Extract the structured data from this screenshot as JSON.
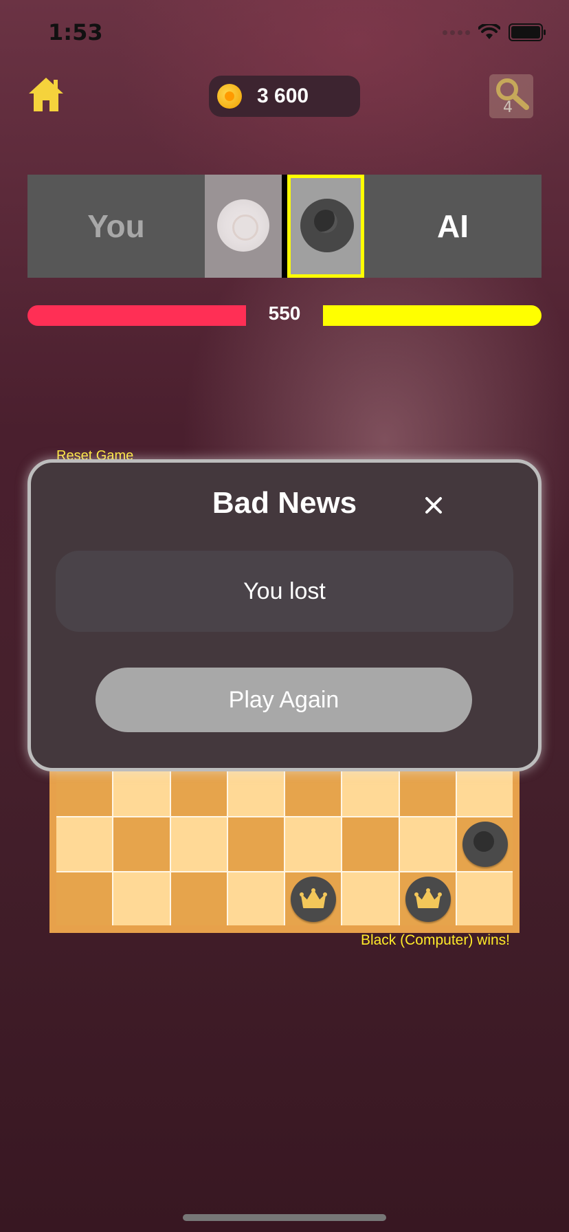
{
  "status_bar": {
    "time": "1:53"
  },
  "top_bar": {
    "coins": "3 600",
    "hint_count": "4"
  },
  "players": {
    "you_label": "You",
    "ai_label": "AI",
    "active_player": "AI",
    "score": "550",
    "colors": {
      "you_bar": "#ff2f55",
      "ai_bar": "#ffff00",
      "active_highlight": "#ffff00"
    }
  },
  "game": {
    "reset_label": "Reset Game",
    "result_text": "Black (Computer) wins!",
    "visible_board_rows": [
      [
        "d",
        "l",
        "d",
        "l",
        "d",
        "l",
        "d",
        "l"
      ],
      [
        "l",
        "d",
        "l",
        "d",
        "l",
        "d",
        "l",
        "d"
      ],
      [
        "d",
        "l",
        "d",
        "l",
        "d",
        "l",
        "d",
        "l"
      ]
    ],
    "pieces": [
      {
        "row": 1,
        "col": 7,
        "color": "black",
        "king": false
      },
      {
        "row": 2,
        "col": 4,
        "color": "black",
        "king": true
      },
      {
        "row": 2,
        "col": 6,
        "color": "black",
        "king": true
      }
    ]
  },
  "modal": {
    "title": "Bad News",
    "message": "You lost",
    "button_label": "Play Again",
    "close_icon": "close-icon"
  }
}
